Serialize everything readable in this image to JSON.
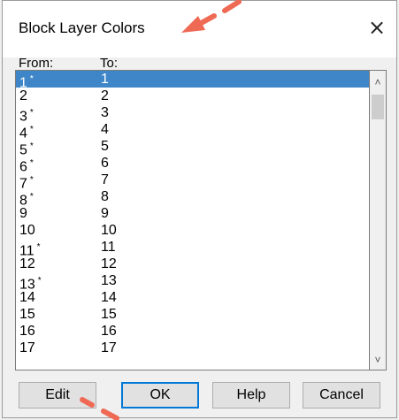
{
  "window": {
    "title": "Block Layer Colors",
    "close_icon": "×"
  },
  "columns": {
    "from": "From:",
    "to": "To:"
  },
  "rows": [
    {
      "from": "1",
      "star": "*",
      "to": "1",
      "selected": true
    },
    {
      "from": "2",
      "star": "",
      "to": "2"
    },
    {
      "from": "3",
      "star": "*",
      "to": "3"
    },
    {
      "from": "4",
      "star": "*",
      "to": "4"
    },
    {
      "from": "5",
      "star": "*",
      "to": "5"
    },
    {
      "from": "6",
      "star": "*",
      "to": "6"
    },
    {
      "from": "7",
      "star": "*",
      "to": "7"
    },
    {
      "from": "8",
      "star": "*",
      "to": "8"
    },
    {
      "from": "9",
      "star": "",
      "to": "9"
    },
    {
      "from": "10",
      "star": "",
      "to": "10"
    },
    {
      "from": "11",
      "star": "*",
      "to": "11"
    },
    {
      "from": "12",
      "star": "",
      "to": "12"
    },
    {
      "from": "13",
      "star": "*",
      "to": "13"
    },
    {
      "from": "14",
      "star": "",
      "to": "14"
    },
    {
      "from": "15",
      "star": "",
      "to": "15"
    },
    {
      "from": "16",
      "star": "",
      "to": "16"
    },
    {
      "from": "17",
      "star": "",
      "to": "17"
    }
  ],
  "buttons": {
    "edit": "Edit",
    "ok": "OK",
    "help": "Help",
    "cancel": "Cancel"
  },
  "colors": {
    "selection": "#3f86c8",
    "annotation_arrow": "#ef6a55",
    "default_button_border": "#0078d7"
  }
}
